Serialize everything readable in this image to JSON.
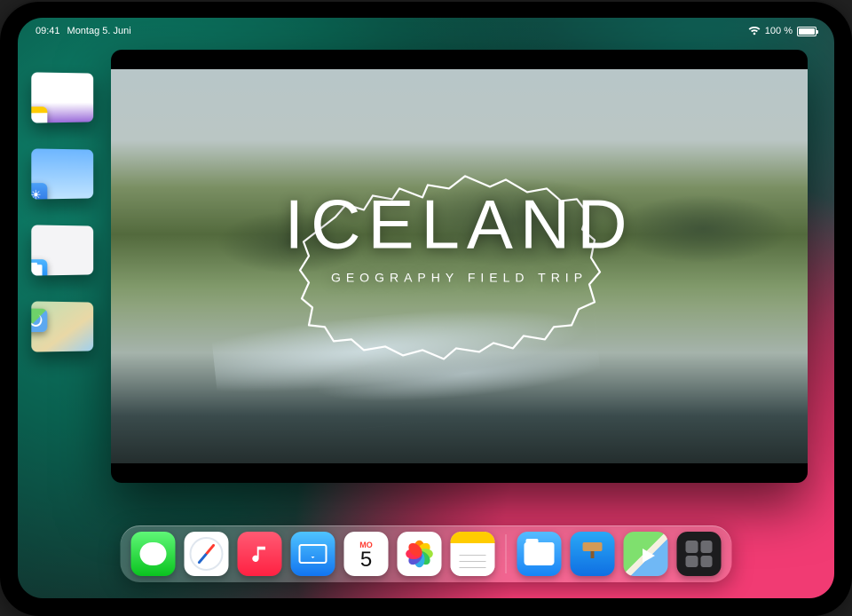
{
  "statusbar": {
    "time": "09:41",
    "date": "Montag 5. Juni",
    "battery_text": "100 %",
    "battery_level": 100
  },
  "stage_items": [
    {
      "name": "notes",
      "app": "Notizen"
    },
    {
      "name": "weather",
      "app": "Wetter"
    },
    {
      "name": "files",
      "app": "Dateien"
    },
    {
      "name": "maps",
      "app": "Karten"
    }
  ],
  "presentation": {
    "title": "ICELAND",
    "subtitle": "GEOGRAPHY FIELD TRIP"
  },
  "calendar_icon": {
    "dow": "MO",
    "dom": "5"
  },
  "dock": [
    {
      "name": "messages",
      "label": "Nachrichten"
    },
    {
      "name": "safari",
      "label": "Safari"
    },
    {
      "name": "music",
      "label": "Musik"
    },
    {
      "name": "mail",
      "label": "Mail"
    },
    {
      "name": "calendar",
      "label": "Kalender"
    },
    {
      "name": "photos",
      "label": "Fotos"
    },
    {
      "name": "notes",
      "label": "Notizen"
    }
  ],
  "dock_recent": [
    {
      "name": "files",
      "label": "Dateien"
    },
    {
      "name": "keynote",
      "label": "Keynote"
    },
    {
      "name": "maps",
      "label": "Karten"
    },
    {
      "name": "stage",
      "label": "Stage Manager"
    }
  ]
}
